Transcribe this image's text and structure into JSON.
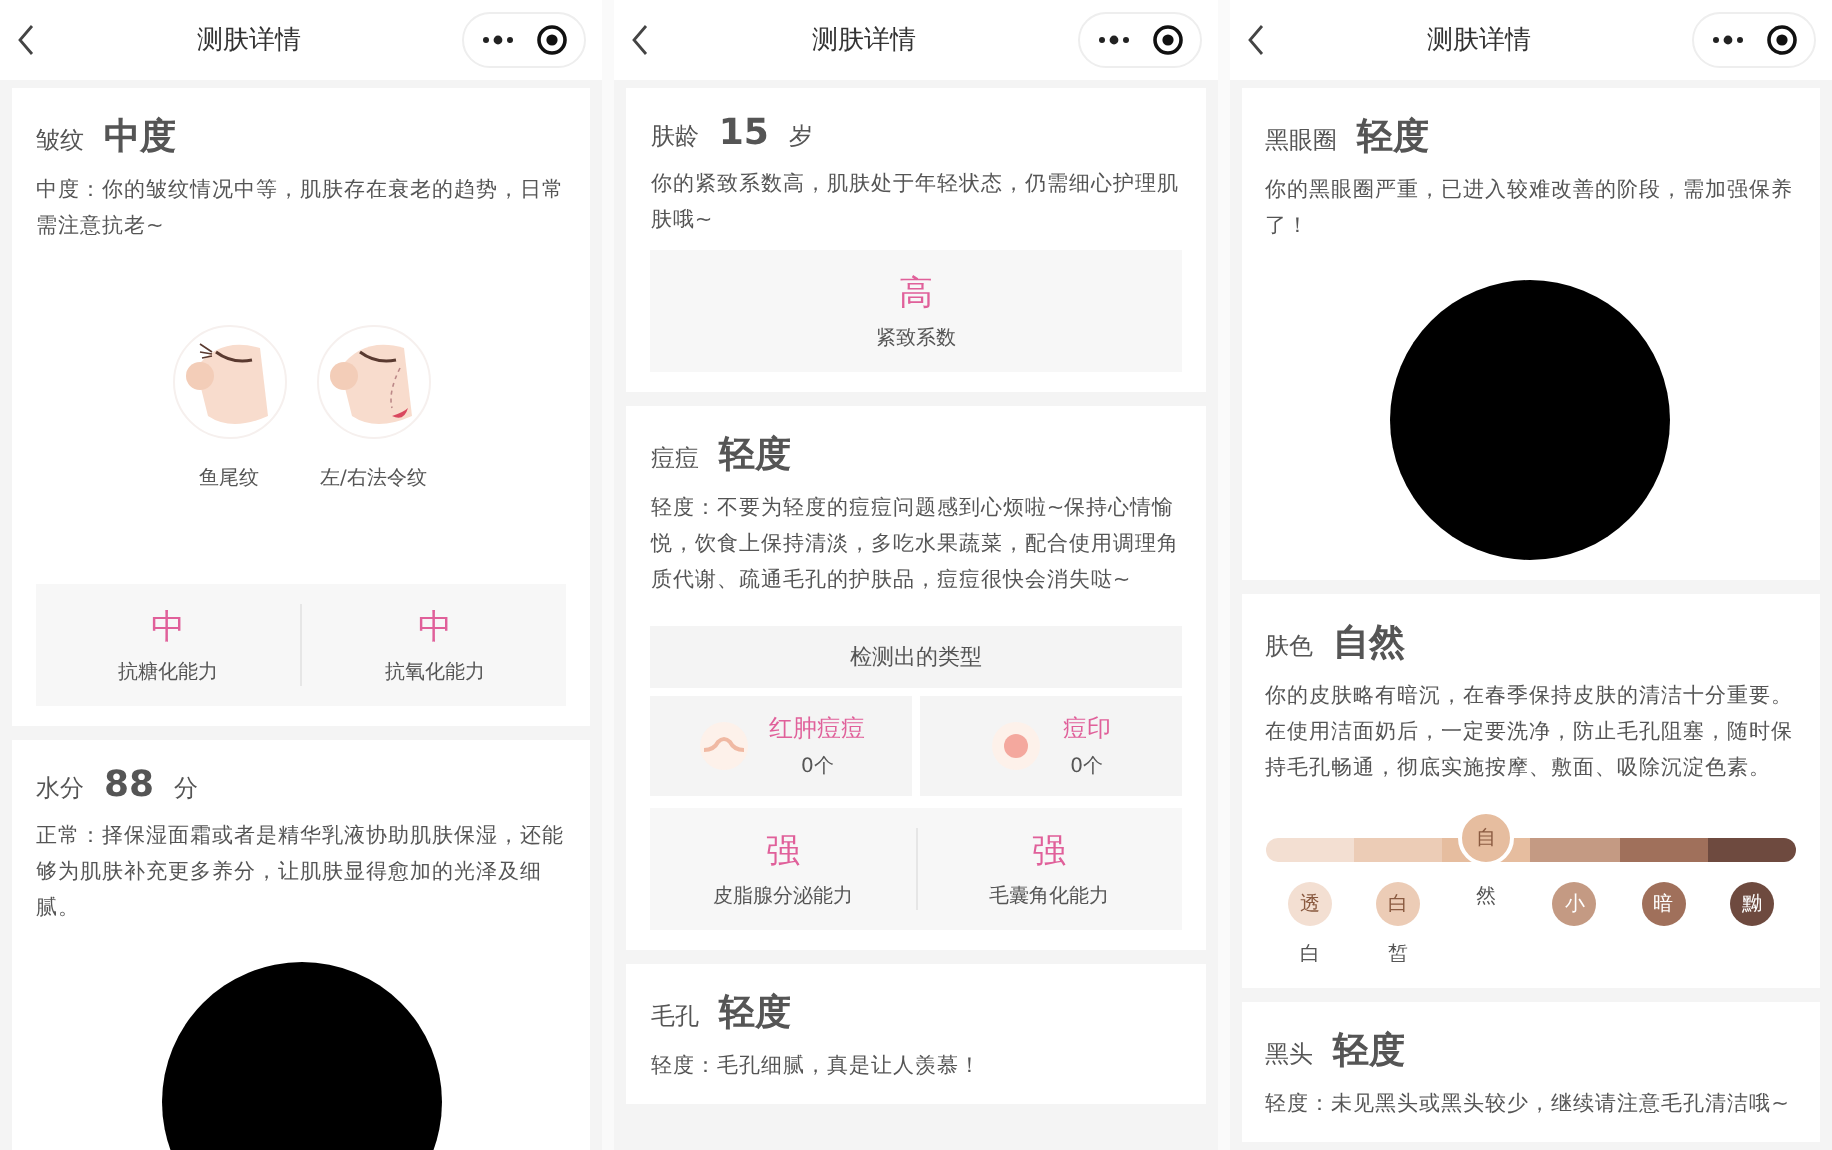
{
  "panels": [
    {
      "title": "测肤详情",
      "cards": [
        {
          "label": "皱纹",
          "grade": "中度",
          "desc": "中度：你的皱纹情况中等，肌肤存在衰老的趋势，日常需注意抗老~",
          "blocks": [
            {
              "kind": "figures",
              "items": [
                {
                  "label": "鱼尾纹"
                },
                {
                  "label": "左/右法令纹"
                }
              ]
            },
            {
              "kind": "metrics",
              "items": [
                {
                  "value": "中",
                  "label": "抗糖化能力"
                },
                {
                  "value": "中",
                  "label": "抗氧化能力"
                }
              ]
            }
          ]
        },
        {
          "label": "水分",
          "grade": "88",
          "unit": "分",
          "desc": "正常：择保湿面霜或者是精华乳液协助肌肤保湿，还能够为肌肤补充更多养分，让肌肤显得愈加的光泽及细腻。",
          "blocks": [
            {
              "kind": "disc"
            }
          ]
        }
      ]
    },
    {
      "title": "测肤详情",
      "cards": [
        {
          "label": "肤龄",
          "grade": "15",
          "unit": "岁",
          "desc": "你的紧致系数高，肌肤处于年轻状态，仍需细心护理肌肤哦~",
          "blocks": [
            {
              "kind": "metrics",
              "items": [
                {
                  "value": "高",
                  "label": "紧致系数"
                }
              ]
            }
          ]
        },
        {
          "label": "痘痘",
          "grade": "轻度",
          "desc": "轻度：不要为轻度的痘痘问题感到心烦啦~保持心情愉悦，饮食上保持清淡，多吃水果蔬菜，配合使用调理角质代谢、疏通毛孔的护肤品，痘痘很快会消失哒~",
          "blocks": [
            {
              "kind": "detected",
              "title": "检测出的类型",
              "items": [
                {
                  "name": "红肿痘痘",
                  "count": "0个"
                },
                {
                  "name": "痘印",
                  "count": "0个"
                }
              ]
            },
            {
              "kind": "metrics",
              "items": [
                {
                  "value": "强",
                  "label": "皮脂腺分泌能力"
                },
                {
                  "value": "强",
                  "label": "毛囊角化能力"
                }
              ]
            }
          ]
        },
        {
          "label": "毛孔",
          "grade": "轻度",
          "desc": "轻度：毛孔细腻，真是让人羡慕！"
        }
      ]
    },
    {
      "title": "测肤详情",
      "cards": [
        {
          "label": "黑眼圈",
          "grade": "轻度",
          "desc": "你的黑眼圈严重，已进入较难改善的阶段，需加强保养了！",
          "blocks": [
            {
              "kind": "disc"
            }
          ]
        },
        {
          "label": "肤色",
          "grade": "自然",
          "desc": "你的皮肤略有暗沉，在春季保持皮肤的清洁十分重要。在使用洁面奶后，一定要洗净，防止毛孔阻塞，随时保持毛孔畅通，彻底实施按摩、敷面、吸除沉淀色素。",
          "blocks": [
            {
              "kind": "tones",
              "items": [
                {
                  "first": "透",
                  "second": "白",
                  "color": "#f3dfd2",
                  "selected": false
                },
                {
                  "first": "白",
                  "second": "皙",
                  "color": "#ecccb6",
                  "selected": false
                },
                {
                  "first": "自",
                  "second": "然",
                  "color": "#e6bd9f",
                  "selected": true
                },
                {
                  "first": "小",
                  "color": "#c49a83",
                  "selected": false
                },
                {
                  "first": "暗",
                  "color": "#a0705b",
                  "selected": false
                },
                {
                  "first": "黝",
                  "color": "#6e4a3f",
                  "selected": false
                }
              ]
            }
          ]
        },
        {
          "label": "黑头",
          "grade": "轻度",
          "desc": "轻度：未见黑头或黑头较少，继续请注意毛孔清洁哦~"
        }
      ]
    }
  ]
}
